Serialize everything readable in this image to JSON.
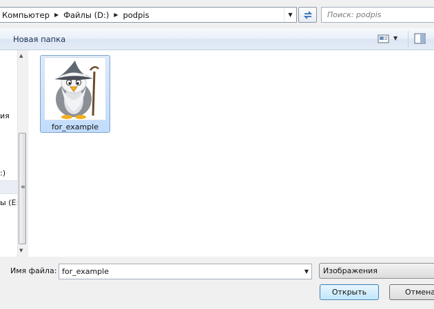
{
  "address_bar": {
    "crumbs": [
      "Компьютер",
      "Файлы (D:)",
      "podpis"
    ]
  },
  "search": {
    "placeholder": "Поиск: podpis"
  },
  "toolbar": {
    "new_folder_label": "Новая папка"
  },
  "nav_pane": {
    "labels": [
      "ия",
      ":)",
      "ы (E:)"
    ]
  },
  "file_list": {
    "items": [
      {
        "name": "for_example",
        "thumbnail": "gandalf-penguin-icon"
      }
    ]
  },
  "bottom_bar": {
    "filename_label": "Имя файла:",
    "filename_value": "for_example",
    "filetype_value": "Изображения",
    "open_label": "Открыть",
    "cancel_label": "Отмена"
  }
}
